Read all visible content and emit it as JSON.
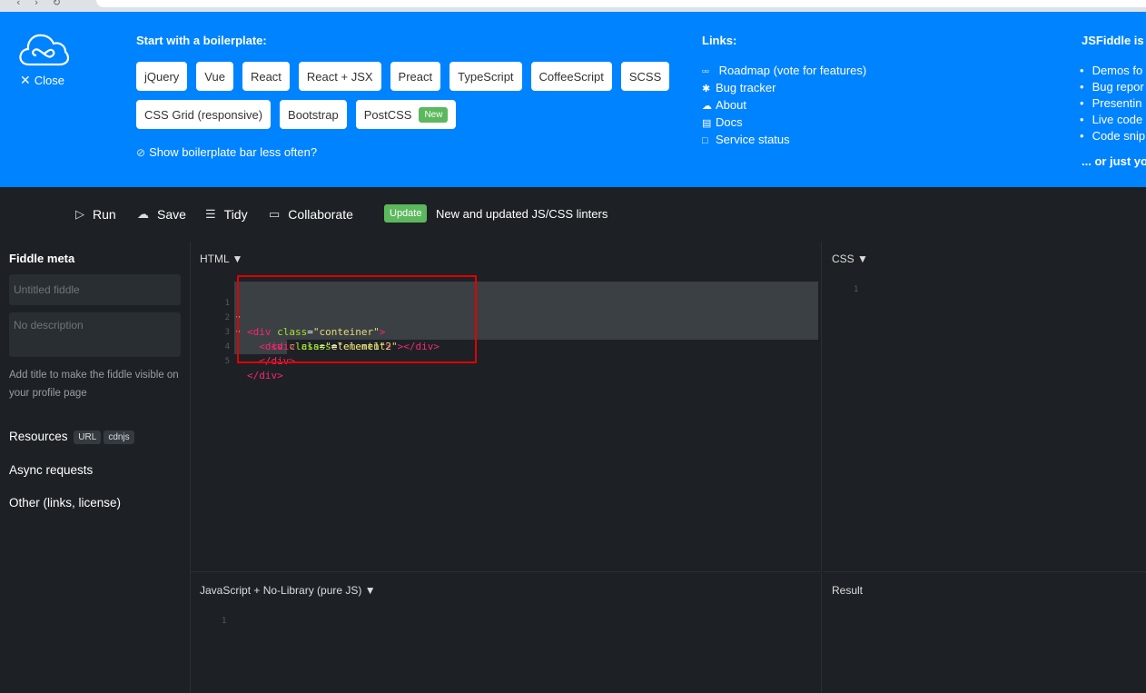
{
  "boilerplate": {
    "title": "Start with a boilerplate:",
    "close_label": "Close",
    "row1": [
      "jQuery",
      "Vue",
      "React",
      "React + JSX",
      "Preact",
      "TypeScript",
      "CoffeeScript",
      "SCSS"
    ],
    "row2": [
      "CSS Grid (responsive)",
      "Bootstrap",
      "PostCSS"
    ],
    "new_badge": "New",
    "show_less": "Show boilerplate bar less often?"
  },
  "links": {
    "title": "Links:",
    "items": [
      {
        "icon": "roadmap-icon",
        "label": "Roadmap (vote for features)"
      },
      {
        "icon": "bug-icon",
        "label": "Bug tracker"
      },
      {
        "icon": "cloud-icon",
        "label": "About"
      },
      {
        "icon": "docs-icon",
        "label": "Docs"
      },
      {
        "icon": "status-icon",
        "label": "Service status"
      }
    ]
  },
  "about": {
    "title": "JSFiddle is",
    "items": [
      "Demos fo",
      "Bug repor",
      "Presentin",
      "Live code",
      "Code snip"
    ],
    "more": "... or just you"
  },
  "toolbar": {
    "run": "Run",
    "save": "Save",
    "tidy": "Tidy",
    "collaborate": "Collaborate",
    "update_badge": "Update",
    "update_text": "New and updated JS/CSS linters"
  },
  "sidebar": {
    "title": "Fiddle meta",
    "title_placeholder": "Untitled fiddle",
    "desc_placeholder": "No description",
    "hint": "Add title to make the fiddle visible on your profile page",
    "resources": "Resources",
    "url_tag": "URL",
    "cdnjs_tag": "cdnjs",
    "async": "Async requests",
    "other": "Other (links, license)"
  },
  "panels": {
    "html_label": "HTML ▼",
    "css_label": "CSS ▼",
    "js_label": "JavaScript + No-Library (pure JS) ▼",
    "result_label": "Result"
  },
  "html_code": {
    "line_numbers": [
      "1",
      "2",
      "3",
      "4",
      "5"
    ],
    "lines": [
      "<div class=\"conteiner\">",
      "  <div class=\"element1\">",
      "    <div class=\"element2\"></div>",
      "  </div>",
      "</div>"
    ]
  },
  "css_code": {
    "line_numbers": [
      "1"
    ]
  },
  "js_code": {
    "line_numbers": [
      "1"
    ]
  }
}
